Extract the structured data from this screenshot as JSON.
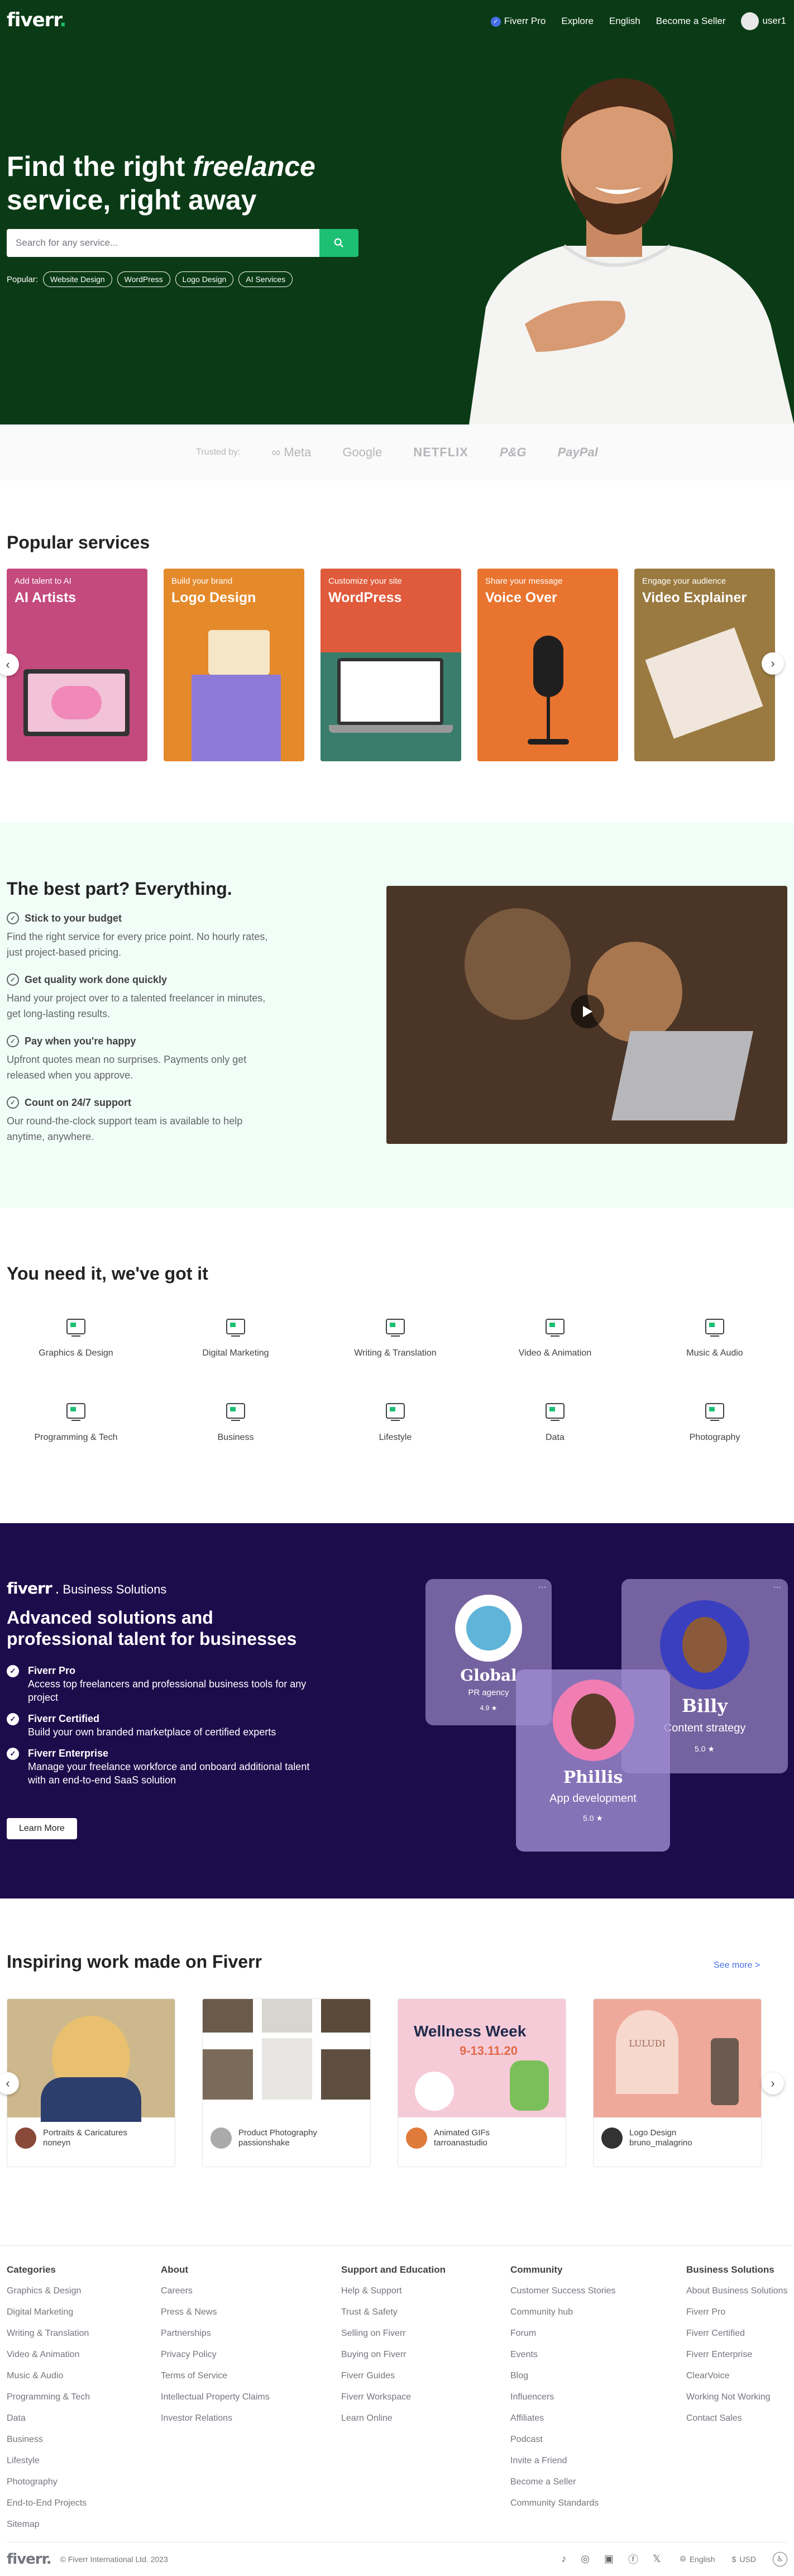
{
  "header": {
    "logo": "fiverr",
    "nav": [
      "Fiverr Pro",
      "Explore",
      "English",
      "Become a Seller"
    ],
    "user": "user1"
  },
  "hero": {
    "title_part1": "Find the right ",
    "title_em": "freelance",
    "title_part2": "service, right away",
    "search_placeholder": "Search for any service...",
    "popular_label": "Popular:",
    "popular": [
      "Website Design",
      "WordPress",
      "Logo Design",
      "AI Services"
    ]
  },
  "trusted": {
    "label": "Trusted by:",
    "brands": [
      "∞ Meta",
      "Google",
      "NETFLIX",
      "P&G",
      "PayPal"
    ]
  },
  "popular_services": {
    "title": "Popular services",
    "items": [
      {
        "small": "Add talent to AI",
        "big": "AI Artists",
        "color": "#c44a7e"
      },
      {
        "small": "Build your brand",
        "big": "Logo Design",
        "color": "#e58a2b"
      },
      {
        "small": "Customize your site",
        "big": "WordPress",
        "color": "#df5b3b"
      },
      {
        "small": "Share your message",
        "big": "Voice Over",
        "color": "#e9742f"
      },
      {
        "small": "Engage your audience",
        "big": "Video Explainer",
        "color": "#9a7a40"
      }
    ]
  },
  "best": {
    "title": "The best part? Everything.",
    "features": [
      {
        "h": "Stick to your budget",
        "p": "Find the right service for every price point. No hourly rates, just project-based pricing."
      },
      {
        "h": "Get quality work done quickly",
        "p": "Hand your project over to a talented freelancer in minutes, get long-lasting results."
      },
      {
        "h": "Pay when you're happy",
        "p": "Upfront quotes mean no surprises. Payments only get released when you approve."
      },
      {
        "h": "Count on 24/7 support",
        "p": "Our round-the-clock support team is available to help anytime, anywhere."
      }
    ]
  },
  "categories": {
    "title": "You need it, we've got it",
    "items": [
      "Graphics & Design",
      "Digital Marketing",
      "Writing & Translation",
      "Video & Animation",
      "Music & Audio",
      "Programming & Tech",
      "Business",
      "Lifestyle",
      "Data",
      "Photography"
    ]
  },
  "business": {
    "logo": "fiverr",
    "logo_suffix": "Business Solutions",
    "title": "Advanced solutions and professional talent for businesses",
    "items": [
      {
        "h": "Fiverr Pro",
        "p": "Access top freelancers and professional business tools for any project"
      },
      {
        "h": "Fiverr Certified",
        "p": "Build your own branded marketplace of certified experts"
      },
      {
        "h": "Fiverr Enterprise",
        "p": "Manage your freelance workforce and onboard additional talent with an end-to-end SaaS solution"
      }
    ],
    "cta": "Learn More",
    "cards": [
      {
        "name": "Global",
        "role": "PR agency",
        "rating": "4.9 ★"
      },
      {
        "name": "Billy",
        "role": "Content strategy",
        "rating": "5.0 ★"
      },
      {
        "name": "Phillis",
        "role": "App development",
        "rating": "5.0 ★"
      }
    ]
  },
  "inspiring": {
    "title": "Inspiring work made on Fiverr",
    "see_more": "See more >",
    "works": [
      {
        "category": "Portraits & Caricatures",
        "user": "noneyn"
      },
      {
        "category": "Product Photography",
        "user": "passionshake"
      },
      {
        "category": "Animated GIFs",
        "user": "tarroanastudio",
        "banner_title": "Wellness Week",
        "banner_date": "9-13.11.20"
      },
      {
        "category": "Logo Design",
        "user": "bruno_malagrino",
        "brand": "LULUDI"
      }
    ]
  },
  "footer": {
    "columns": [
      {
        "title": "Categories",
        "links": [
          "Graphics & Design",
          "Digital Marketing",
          "Writing & Translation",
          "Video & Animation",
          "Music & Audio",
          "Programming & Tech",
          "Data",
          "Business",
          "Lifestyle",
          "Photography",
          "End-to-End Projects",
          "Sitemap"
        ]
      },
      {
        "title": "About",
        "links": [
          "Careers",
          "Press & News",
          "Partnerships",
          "Privacy Policy",
          "Terms of Service",
          "Intellectual Property Claims",
          "Investor Relations"
        ]
      },
      {
        "title": "Support and Education",
        "links": [
          "Help & Support",
          "Trust & Safety",
          "Selling on Fiverr",
          "Buying on Fiverr",
          "Fiverr Guides",
          "Fiverr Workspace",
          "Learn Online"
        ]
      },
      {
        "title": "Community",
        "links": [
          "Customer Success Stories",
          "Community hub",
          "Forum",
          "Events",
          "Blog",
          "Influencers",
          "Affiliates",
          "Podcast",
          "Invite a Friend",
          "Become a Seller",
          "Community Standards"
        ]
      },
      {
        "title": "Business Solutions",
        "links": [
          "About Business Solutions",
          "Fiverr Pro",
          "Fiverr Certified",
          "Fiverr Enterprise",
          "ClearVoice",
          "Working Not Working",
          "Contact Sales"
        ]
      }
    ],
    "logo": "fiverr",
    "copyright": "© Fiverr International Ltd. 2023",
    "language": "English",
    "currency": "USD"
  },
  "colors": {
    "green": "#1dbf73",
    "hero_bg": "#0b3b16",
    "business_bg": "#1d0c4c"
  }
}
